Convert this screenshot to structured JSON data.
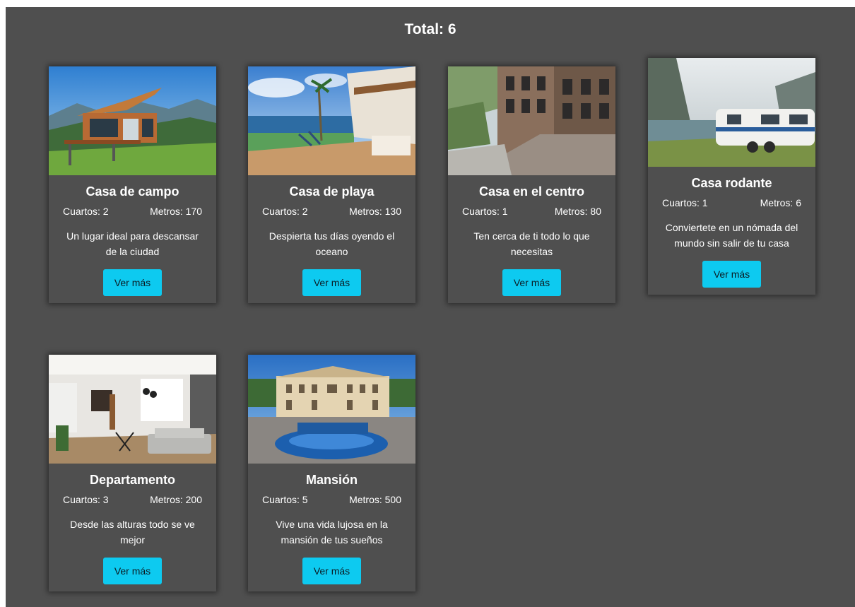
{
  "header": {
    "total_label": "Total: 6"
  },
  "button_color": "#0dcaf0",
  "properties": [
    {
      "title": "Casa de campo",
      "rooms": "Cuartos: 2",
      "meters": "Metros: 170",
      "description": "Un lugar ideal para descansar de la ciudad",
      "button": "Ver más",
      "image_icon": "country-house-photo"
    },
    {
      "title": "Casa de playa",
      "rooms": "Cuartos: 2",
      "meters": "Metros: 130",
      "description": "Despierta tus días oyendo el oceano",
      "button": "Ver más",
      "image_icon": "beach-house-photo"
    },
    {
      "title": "Casa en el centro",
      "rooms": "Cuartos: 1",
      "meters": "Metros: 80",
      "description": "Ten cerca de ti todo lo que necesitas",
      "button": "Ver más",
      "image_icon": "townhouse-photo"
    },
    {
      "title": "Casa rodante",
      "rooms": "Cuartos: 1",
      "meters": "Metros: 6",
      "description": "Conviertete en un nómada del mundo sin salir de tu casa",
      "button": "Ver más",
      "image_icon": "caravan-photo"
    },
    {
      "title": "Departamento",
      "rooms": "Cuartos: 3",
      "meters": "Metros: 200",
      "description": "Desde las alturas todo se ve mejor",
      "button": "Ver más",
      "image_icon": "apartment-photo"
    },
    {
      "title": "Mansión",
      "rooms": "Cuartos: 5",
      "meters": "Metros: 500",
      "description": "Vive una vida lujosa en la mansión de tus sueños",
      "button": "Ver más",
      "image_icon": "mansion-photo"
    }
  ]
}
